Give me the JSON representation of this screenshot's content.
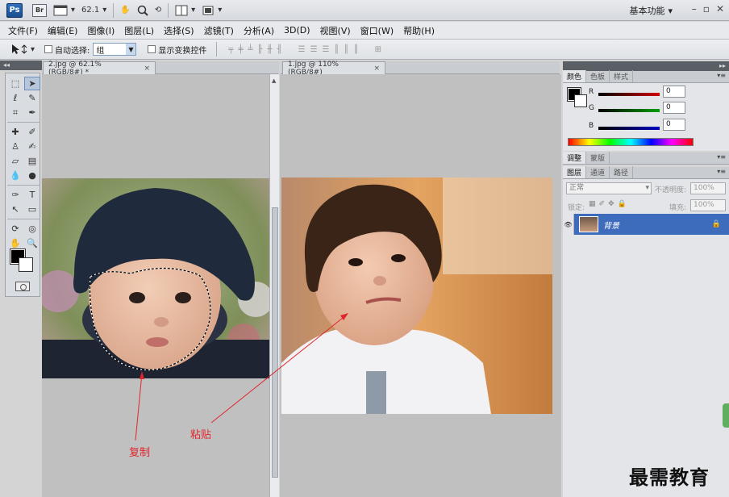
{
  "app": {
    "logo": "Ps",
    "bridge_logo": "Br",
    "zoom": "62.1",
    "workspace": "基本功能",
    "window_controls": [
      "–",
      "▫",
      "✕"
    ]
  },
  "menu": [
    "文件(F)",
    "编辑(E)",
    "图像(I)",
    "图层(L)",
    "选择(S)",
    "滤镜(T)",
    "分析(A)",
    "3D(D)",
    "视图(V)",
    "窗口(W)",
    "帮助(H)"
  ],
  "options": {
    "auto_select_label": "自动选择:",
    "auto_select_value": "组",
    "show_transform_label": "显示变换控件"
  },
  "tabs": {
    "doc1": "2.jpg @ 62.1%(RGB/8#) *",
    "doc2": "1.jpg @ 110%(RGB/8#)",
    "close": "×"
  },
  "panels": {
    "color_tabs": [
      "颜色",
      "色板",
      "样式"
    ],
    "adjust_tabs": [
      "调整",
      "蒙版"
    ],
    "layer_tabs": [
      "图层",
      "通道",
      "路径"
    ],
    "rgb": [
      {
        "label": "R",
        "value": "0",
        "color": "#d00000"
      },
      {
        "label": "G",
        "value": "0",
        "color": "#00a000"
      },
      {
        "label": "B",
        "value": "0",
        "color": "#0000c0"
      }
    ],
    "blend_mode": "正常",
    "opacity_label": "不透明度:",
    "opacity_value": "100%",
    "lock_label": "锁定:",
    "fill_label": "填充:",
    "fill_value": "100%",
    "layer_name": "背景"
  },
  "annotations": {
    "copy": "复制",
    "paste": "粘贴"
  },
  "watermark": "最需教育"
}
